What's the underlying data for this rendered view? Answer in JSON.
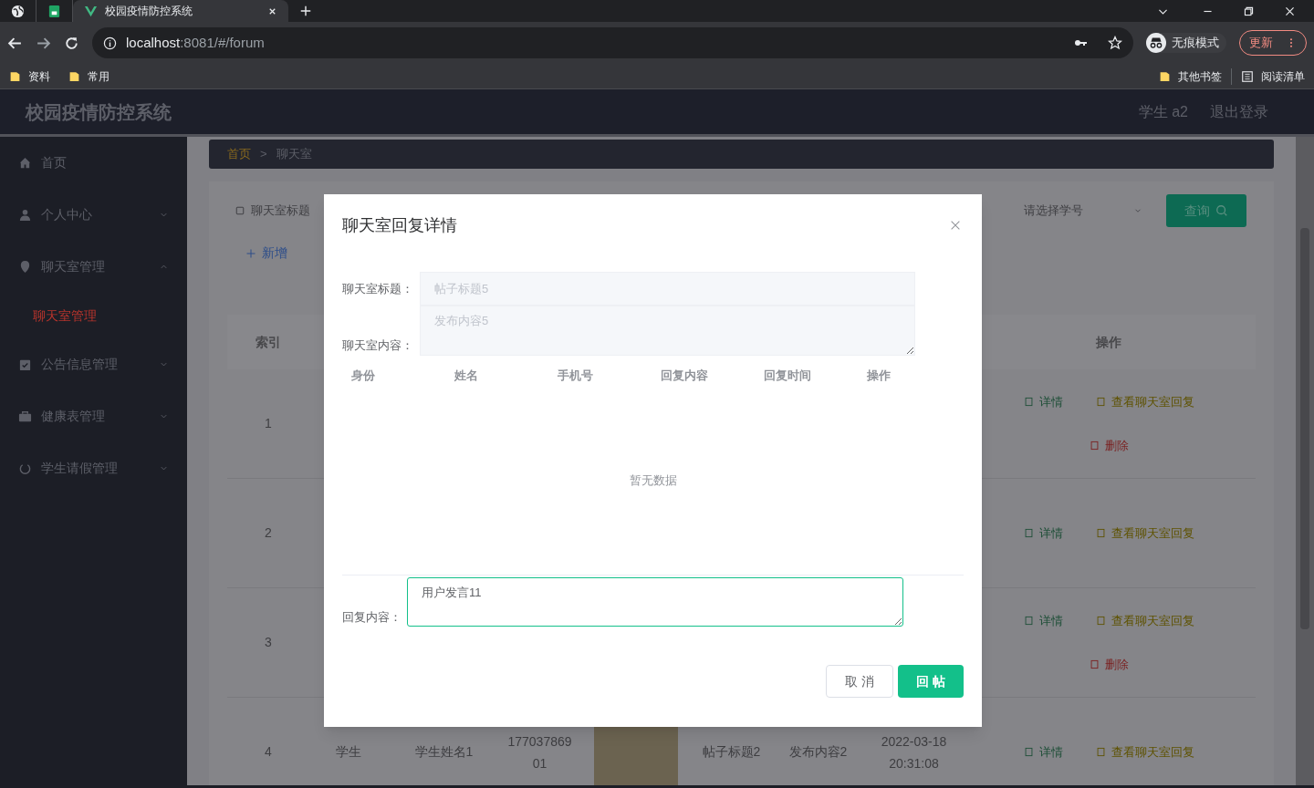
{
  "browser": {
    "tabs": [
      {
        "kind": "globe",
        "selected": false
      },
      {
        "kind": "sheet",
        "selected": false
      },
      {
        "kind": "app",
        "title": "校园疫情防控系统",
        "selected": true
      }
    ],
    "url_host": "localhost",
    "url_rest": ":8081/#/forum",
    "profile": "无痕模式",
    "update_button": "更新",
    "bookmarks": [
      "资料",
      "常用"
    ],
    "other_bookmarks": "其他书签",
    "reading_list": "阅读清单"
  },
  "app": {
    "title": "校园疫情防控系统",
    "user": "学生 a2",
    "logout": "退出登录"
  },
  "sidebar": {
    "items": [
      {
        "kind": "link",
        "label": "首页"
      },
      {
        "kind": "group",
        "label": "个人中心",
        "expanded": false
      },
      {
        "kind": "group",
        "label": "聊天室管理",
        "expanded": true,
        "children": [
          {
            "label": "聊天室管理",
            "selected": true
          }
        ]
      },
      {
        "kind": "group",
        "label": "公告信息管理",
        "expanded": false
      },
      {
        "kind": "group",
        "label": "健康表管理",
        "expanded": false
      },
      {
        "kind": "group",
        "label": "学生请假管理",
        "expanded": false
      }
    ]
  },
  "breadcrumb": {
    "items": [
      "首页",
      "聊天室"
    ],
    "separator": ">"
  },
  "search": {
    "title_placeholder": "聊天室标题",
    "select_placeholder": "请选择学号",
    "button": "查询"
  },
  "add_button": "新增",
  "table": {
    "columns": {
      "index": "索引",
      "actions": "操作"
    },
    "rows": [
      {
        "index": "1",
        "actions": [
          {
            "kind": "detail",
            "label": "详情"
          },
          {
            "kind": "reply",
            "label": "查看聊天室回复"
          },
          {
            "kind": "delete",
            "label": "删除"
          }
        ]
      },
      {
        "index": "2",
        "actions": [
          {
            "kind": "detail",
            "label": "详情"
          },
          {
            "kind": "reply",
            "label": "查看聊天室回复"
          }
        ]
      },
      {
        "index": "3",
        "actions": [
          {
            "kind": "detail",
            "label": "详情"
          },
          {
            "kind": "reply",
            "label": "查看聊天室回复"
          },
          {
            "kind": "delete",
            "label": "删除"
          }
        ]
      },
      {
        "index": "4",
        "identity": "学生",
        "name": "学生姓名1",
        "phone": "17703786901",
        "has_image": true,
        "title": "帖子标题2",
        "content": "发布内容2",
        "time": "2022-03-18 20:31:08",
        "actions": [
          {
            "kind": "detail",
            "label": "详情"
          },
          {
            "kind": "reply",
            "label": "查看聊天室回复"
          }
        ]
      }
    ]
  },
  "modal": {
    "title": "聊天室回复详情",
    "fields": [
      {
        "kind": "input",
        "label": "聊天室标题：",
        "value": "帖子标题5",
        "disabled": true
      },
      {
        "kind": "textarea",
        "label": "聊天室内容：",
        "value": "发布内容5",
        "disabled": true
      }
    ],
    "reply_table": {
      "columns": [
        "身份",
        "姓名",
        "手机号",
        "回复内容",
        "回复时间",
        "操作"
      ],
      "empty_text": "暂无数据"
    },
    "reply": {
      "label": "回复内容：",
      "value": "用户发言11"
    },
    "buttons": [
      {
        "kind": "default",
        "label": "取 消"
      },
      {
        "kind": "primary",
        "label": "回 帖"
      }
    ]
  }
}
